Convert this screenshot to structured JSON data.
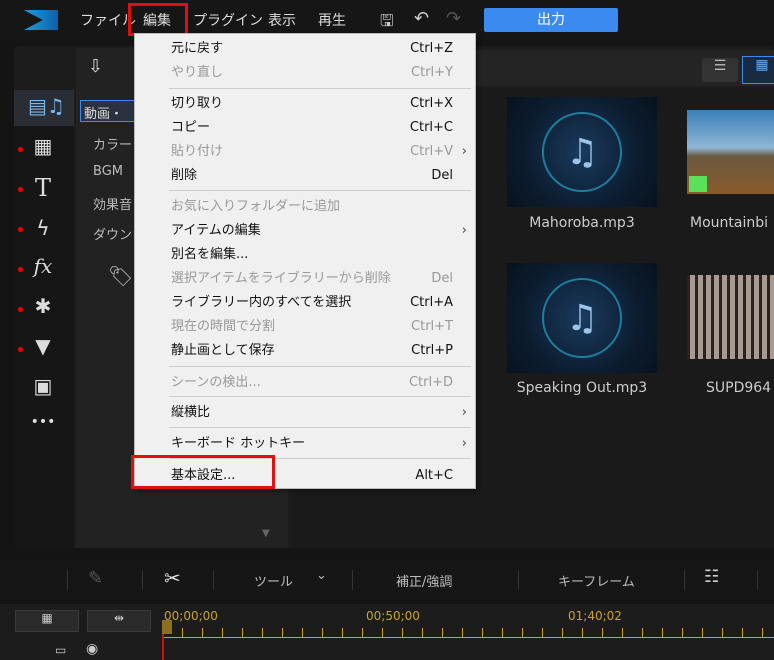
{
  "menubar": {
    "items": [
      "ファイル",
      "編集",
      "プラグイン",
      "表示",
      "再生"
    ],
    "output": "出力"
  },
  "library": {
    "categories": [
      "動画・",
      "カラー",
      "BGM",
      "効果音",
      "ダウンロ"
    ]
  },
  "media": [
    {
      "name": "Mahoroba.mp3",
      "type": "audio"
    },
    {
      "name": "Mountainbi",
      "type": "video"
    },
    {
      "name": "Speaking Out.mp3",
      "type": "audio"
    },
    {
      "name": "SUPD964",
      "type": "video"
    }
  ],
  "edit_menu": [
    {
      "label": "元に戻す",
      "shortcut": "Ctrl+Z",
      "enabled": true
    },
    {
      "label": "やり直し",
      "shortcut": "Ctrl+Y",
      "enabled": false
    },
    {
      "label": "切り取り",
      "shortcut": "Ctrl+X",
      "enabled": true
    },
    {
      "label": "コピー",
      "shortcut": "Ctrl+C",
      "enabled": true
    },
    {
      "label": "貼り付け",
      "shortcut": "Ctrl+V",
      "enabled": false
    },
    {
      "label": "削除",
      "shortcut": "Del",
      "enabled": true
    },
    {
      "label": "お気に入りフォルダーに追加",
      "shortcut": "",
      "enabled": false
    },
    {
      "label": "アイテムの編集",
      "shortcut": "",
      "enabled": true
    },
    {
      "label": "別名を編集...",
      "shortcut": "",
      "enabled": true
    },
    {
      "label": "選択アイテムをライブラリーから削除",
      "shortcut": "Del",
      "enabled": false
    },
    {
      "label": "ライブラリー内のすべてを選択",
      "shortcut": "Ctrl+A",
      "enabled": true
    },
    {
      "label": "現在の時間で分割",
      "shortcut": "Ctrl+T",
      "enabled": false
    },
    {
      "label": "静止画として保存",
      "shortcut": "Ctrl+P",
      "enabled": true
    },
    {
      "label": "シーンの検出...",
      "shortcut": "Ctrl+D",
      "enabled": false
    },
    {
      "label": "縦横比",
      "shortcut": "",
      "enabled": true
    },
    {
      "label": "キーボード ホットキー",
      "shortcut": "",
      "enabled": true
    },
    {
      "label": "基本設定...",
      "shortcut": "Alt+C",
      "enabled": true
    }
  ],
  "toolbar": {
    "tool": "ツール",
    "fix": "補正/強調",
    "keyframe": "キーフレーム"
  },
  "timeline": {
    "timecodes": [
      "00;00;00",
      "00;50;00",
      "01;40;02"
    ]
  },
  "colors": {
    "accent": "#3b8af0",
    "highlight": "#e01010",
    "timecode": "#c9a227"
  }
}
